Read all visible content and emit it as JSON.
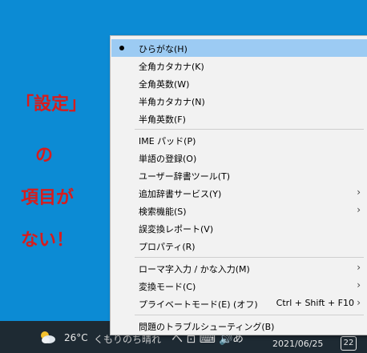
{
  "annotation": {
    "lines": [
      "「設定」",
      "の",
      "項目が",
      "ない！"
    ]
  },
  "menu": {
    "items": [
      {
        "label": "ひらがな(H)",
        "checked": true
      },
      {
        "label": "全角カタカナ(K)"
      },
      {
        "label": "全角英数(W)"
      },
      {
        "label": "半角カタカナ(N)"
      },
      {
        "label": "半角英数(F)"
      },
      {
        "label": "IME パッド(P)"
      },
      {
        "label": "単語の登録(O)"
      },
      {
        "label": "ユーザー辞書ツール(T)"
      },
      {
        "label": "追加辞書サービス(Y)",
        "submenu": true
      },
      {
        "label": "検索機能(S)",
        "submenu": true
      },
      {
        "label": "誤変換レポート(V)"
      },
      {
        "label": "プロパティ(R)"
      },
      {
        "label": "ローマ字入力 / かな入力(M)",
        "submenu": true
      },
      {
        "label": "変換モード(C)",
        "submenu": true
      },
      {
        "label": "プライベートモード(E) (オフ)",
        "shortcut": "Ctrl + Shift + F10",
        "submenu": true
      },
      {
        "label": "問題のトラブルシューティング(B)"
      }
    ]
  },
  "taskbar": {
    "temperature": "26°C",
    "condition": "くもりのち晴れ",
    "tray": "ヘ  ⊡  ⌨  🔊",
    "ime_indicator": "あ",
    "date": "2021/06/25",
    "notification_count": "22"
  },
  "colors": {
    "desktop": "#0c8bd4",
    "annotation_text": "#d81c1c",
    "menu_background": "#f2f2f2",
    "checked_highlight": "#9ccbf3",
    "taskbar": "#1e2a33"
  }
}
